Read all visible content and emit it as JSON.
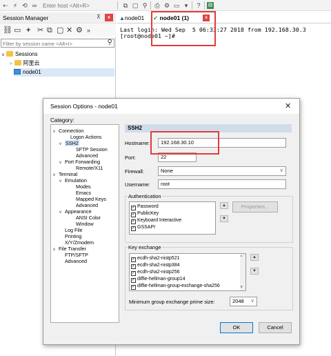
{
  "toolbar": {
    "host_placeholder": "Enter host <Alt+R>",
    "left_icons": [
      "connect-icon",
      "lightning-icon",
      "reconnect-icon",
      "disconnect-icon"
    ],
    "right_icons": [
      "copy-icon",
      "paste-icon",
      "find-icon",
      "print-icon",
      "sftp-icon",
      "keymap-icon",
      "help-icon",
      "screen-icon"
    ]
  },
  "session_manager": {
    "title": "Session Manager",
    "pin": "⊼",
    "close": "x",
    "filter_placeholder": "Filter by session name <Alt+I>",
    "tree": [
      {
        "label": "Sessions",
        "type": "folder",
        "expanded": true
      },
      {
        "label": "阿里云",
        "type": "folder",
        "expanded": false
      },
      {
        "label": "node01",
        "type": "session"
      }
    ]
  },
  "tabs": [
    {
      "label": "node01",
      "state": "warning"
    },
    {
      "label": "node01 (1)",
      "state": "connected",
      "close": "x"
    }
  ],
  "terminal": {
    "lines": [
      "Last login: Wed Sep  5 06:33:27 2018 from 192.168.30.3",
      "[root@node01 ~]#"
    ]
  },
  "dialog": {
    "title": "Session Options - node01",
    "close": "✕",
    "category_label": "Category:",
    "categories": [
      {
        "label": "Connection",
        "level": 0,
        "arrow": "v"
      },
      {
        "label": "Logon Actions",
        "level": 2
      },
      {
        "label": "SSH2",
        "level": 1,
        "arrow": "v",
        "selected": true
      },
      {
        "label": "SFTP Session",
        "level": 3
      },
      {
        "label": "Advanced",
        "level": 3
      },
      {
        "label": "Port Forwarding",
        "level": 1,
        "arrow": "v"
      },
      {
        "label": "Remote/X11",
        "level": 3
      },
      {
        "label": "Terminal",
        "level": 0,
        "arrow": "v"
      },
      {
        "label": "Emulation",
        "level": 1,
        "arrow": "v"
      },
      {
        "label": "Modes",
        "level": 3
      },
      {
        "label": "Emacs",
        "level": 3
      },
      {
        "label": "Mapped Keys",
        "level": 3
      },
      {
        "label": "Advanced",
        "level": 3
      },
      {
        "label": "Appearance",
        "level": 1,
        "arrow": "v"
      },
      {
        "label": "ANSI Color",
        "level": 3
      },
      {
        "label": "Window",
        "level": 3
      },
      {
        "label": "Log File",
        "level": 2
      },
      {
        "label": "Printing",
        "level": 2
      },
      {
        "label": "X/Y/Zmodem",
        "level": 2
      },
      {
        "label": "File Transfer",
        "level": 0,
        "arrow": "v"
      },
      {
        "label": "FTP/SFTP",
        "level": 2
      },
      {
        "label": "Advanced",
        "level": 2
      }
    ],
    "panel_title": "SSH2",
    "hostname_label": "Hostname:",
    "hostname_value": "192.168.30.10",
    "port_label": "Port:",
    "port_value": "22",
    "firewall_label": "Firewall:",
    "firewall_value": "None",
    "username_label": "Username:",
    "username_value": "root",
    "auth_label": "Authentication",
    "auth_methods": [
      {
        "label": "Password",
        "checked": true
      },
      {
        "label": "PublicKey",
        "checked": true
      },
      {
        "label": "Keyboard Interactive",
        "checked": true
      },
      {
        "label": "GSSAPI",
        "checked": true
      }
    ],
    "properties_label": "Properties...",
    "kex_label": "Key exchange",
    "kex_methods": [
      {
        "label": "ecdh-sha2-nistp521",
        "checked": true
      },
      {
        "label": "ecdh-sha2-nistp384",
        "checked": true
      },
      {
        "label": "ecdh-sha2-nistp256",
        "checked": true
      },
      {
        "label": "diffie-hellman-group14",
        "checked": true
      },
      {
        "label": "diffie-hellman-group-exchange-sha256",
        "checked": true
      }
    ],
    "min_prime_label": "Minimum group exchange prime size:",
    "min_prime_value": "2048",
    "ok_label": "OK",
    "cancel_label": "Cancel"
  },
  "colors": {
    "highlight_red": "#e23a3a",
    "close_red": "#e04343",
    "connected_green": "#23a23a",
    "panel_header": "#cfdcea"
  }
}
